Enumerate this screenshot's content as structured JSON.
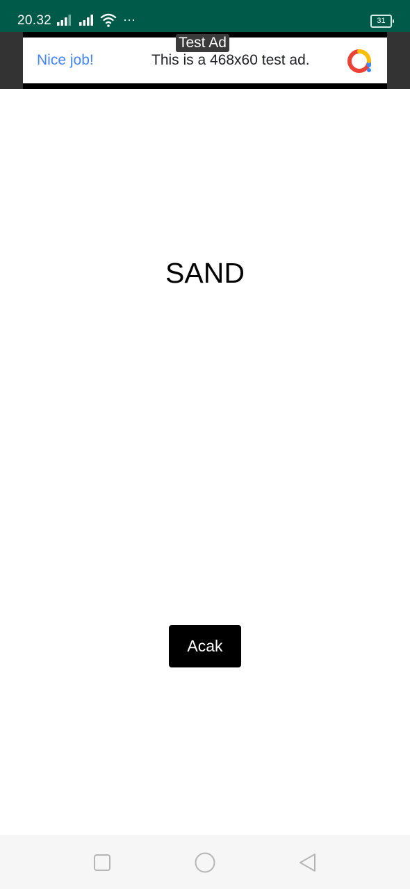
{
  "status_bar": {
    "time": "20.32",
    "battery": "31",
    "more_indicator": "···",
    "icons": [
      "signal-icon",
      "signal-icon",
      "wifi-icon",
      "battery-icon"
    ]
  },
  "ad": {
    "label": "Test Ad",
    "headline": "Nice job!",
    "body": "This is a 468x60 test ad.",
    "icon": "admob-logo-icon"
  },
  "main": {
    "word": "SAND",
    "button_label": "Acak"
  },
  "nav_bar": {
    "icons": [
      "recent-apps-icon",
      "home-icon",
      "back-icon"
    ]
  },
  "colors": {
    "status_bar": "#005a4a",
    "ad_link": "#4285f4",
    "button_bg": "#000000",
    "button_text": "#ffffff"
  }
}
